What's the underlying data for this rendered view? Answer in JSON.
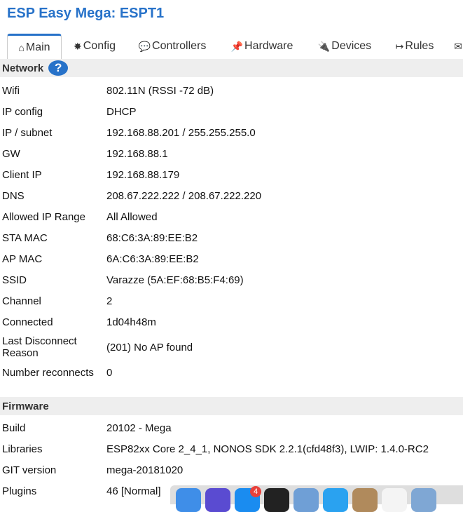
{
  "app": {
    "title": "ESP Easy Mega: ESPT1"
  },
  "tabs": [
    {
      "icon": "⌂",
      "label": "Main"
    },
    {
      "icon": "✸",
      "label": "Config"
    },
    {
      "icon": "💬",
      "label": "Controllers"
    },
    {
      "icon": "📌",
      "label": "Hardware"
    },
    {
      "icon": "🔌",
      "label": "Devices"
    },
    {
      "icon": "↦",
      "label": "Rules"
    },
    {
      "icon": "✉",
      "label": ""
    }
  ],
  "network": {
    "heading": "Network",
    "help": "?",
    "rows": [
      {
        "label": "Wifi",
        "value": "802.11N (RSSI -72 dB)"
      },
      {
        "label": "IP config",
        "value": "DHCP"
      },
      {
        "label": "IP / subnet",
        "value": "192.168.88.201 / 255.255.255.0"
      },
      {
        "label": "GW",
        "value": "192.168.88.1"
      },
      {
        "label": "Client IP",
        "value": "192.168.88.179"
      },
      {
        "label": "DNS",
        "value": "208.67.222.222 / 208.67.222.220"
      },
      {
        "label": "Allowed IP Range",
        "value": "All Allowed"
      },
      {
        "label": "STA MAC",
        "value": "68:C6:3A:89:EE:B2"
      },
      {
        "label": "AP MAC",
        "value": "6A:C6:3A:89:EE:B2"
      },
      {
        "label": "SSID",
        "value": "Varazze (5A:EF:68:B5:F4:69)"
      },
      {
        "label": "Channel",
        "value": "2"
      },
      {
        "label": "Connected",
        "value": "1d04h48m"
      },
      {
        "label": "Last Disconnect Reason",
        "value": "(201) No AP found"
      },
      {
        "label": "Number reconnects",
        "value": "0"
      }
    ]
  },
  "firmware": {
    "heading": "Firmware",
    "rows": [
      {
        "label": "Build",
        "value": "20102 - Mega"
      },
      {
        "label": "Libraries",
        "value": "ESP82xx Core 2_4_1, NONOS SDK 2.2.1(cfd48f3), LWIP: 1.4.0-RC2"
      },
      {
        "label": "GIT version",
        "value": "mega-20181020"
      },
      {
        "label": "Plugins",
        "value": "46 [Normal]"
      }
    ]
  },
  "dock": {
    "badge_count": "4",
    "items": [
      {
        "icon": "finder-icon",
        "color": "#3f8ee8"
      },
      {
        "icon": "siri-icon",
        "color": "#5a4bd1"
      },
      {
        "icon": "app-store-icon",
        "color": "#1a8cf0"
      },
      {
        "icon": "clock-icon",
        "color": "#222222"
      },
      {
        "icon": "preview-icon",
        "color": "#6f9fd6"
      },
      {
        "icon": "safari-icon",
        "color": "#2aa2f0"
      },
      {
        "icon": "contacts-icon",
        "color": "#b08a5c"
      },
      {
        "icon": "calendar-icon",
        "color": "#f4f4f4"
      },
      {
        "icon": "photos-icon",
        "color": "#7fa7d4"
      }
    ]
  }
}
